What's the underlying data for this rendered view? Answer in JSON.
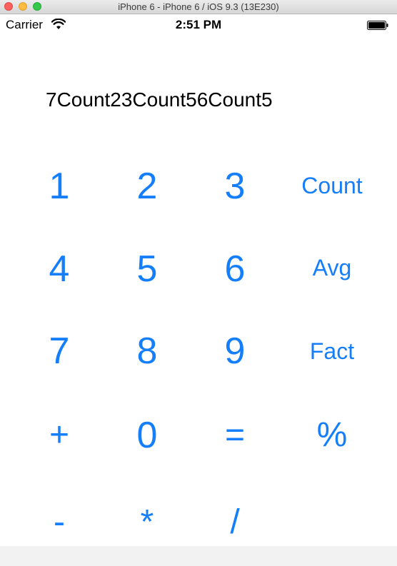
{
  "window": {
    "title": "iPhone 6 - iPhone 6 / iOS 9.3 (13E230)"
  },
  "status_bar": {
    "carrier": "Carrier",
    "time": "2:51 PM",
    "wifi_icon": "wifi-icon",
    "battery_icon": "battery-icon"
  },
  "display": {
    "text": "7Count23Count56Count5"
  },
  "keypad": {
    "row1": [
      "1",
      "2",
      "3",
      "Count"
    ],
    "row2": [
      "4",
      "5",
      "6",
      "Avg"
    ],
    "row3": [
      "7",
      "8",
      "9",
      "Fact"
    ],
    "row4": [
      "+",
      "0",
      "=",
      "%"
    ],
    "row5": [
      "-",
      "*",
      "/"
    ]
  },
  "colors": {
    "accent": "#157efb",
    "text": "#000000",
    "background": "#ffffff"
  }
}
